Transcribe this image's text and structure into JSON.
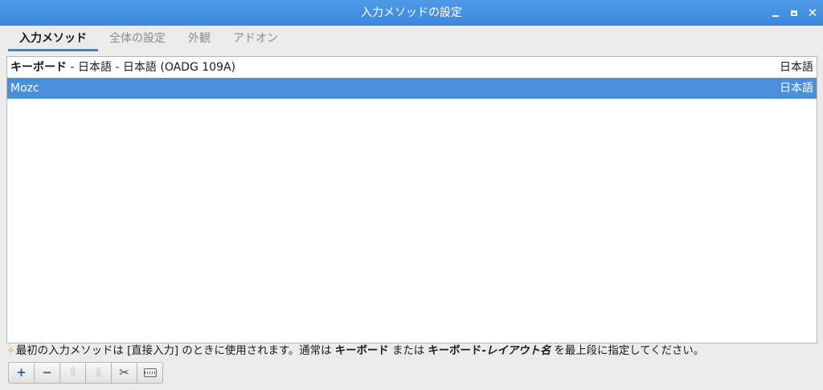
{
  "window": {
    "title": "入力メソッドの設定"
  },
  "tabs": [
    {
      "label": "入力メソッド",
      "active": true
    },
    {
      "label": "全体の設定",
      "active": false
    },
    {
      "label": "外観",
      "active": false
    },
    {
      "label": "アドオン",
      "active": false
    }
  ],
  "list": {
    "items": [
      {
        "name_bold": "キーボード",
        "name_rest": " - 日本語 - 日本語 (OADG 109A)",
        "language": "日本語",
        "selected": false
      },
      {
        "name_bold": "",
        "name_rest": "Mozc",
        "language": "日本語",
        "selected": true
      }
    ]
  },
  "hint": {
    "part1": "最初の入力メソッドは [直接入力] のときに使用されます。通常は ",
    "bold1": "キーボード",
    "part2": " または ",
    "bold2": "キーボード-",
    "italic": "レイアウト名",
    "part3": " を最上段に指定してください。"
  },
  "toolbar": {
    "add": "+",
    "remove": "−",
    "up": "⇧",
    "down": "⇩",
    "configure": "✂",
    "keyboard": ""
  },
  "colors": {
    "titlebar": "#3c87dc",
    "selection": "#4a90d9",
    "tab_underline": "#3c87dc"
  },
  "icons": [
    "minimize-icon",
    "maximize-icon",
    "close-icon",
    "add-icon",
    "remove-icon",
    "move-up-icon",
    "move-down-icon",
    "configure-icon",
    "keyboard-layout-icon"
  ]
}
